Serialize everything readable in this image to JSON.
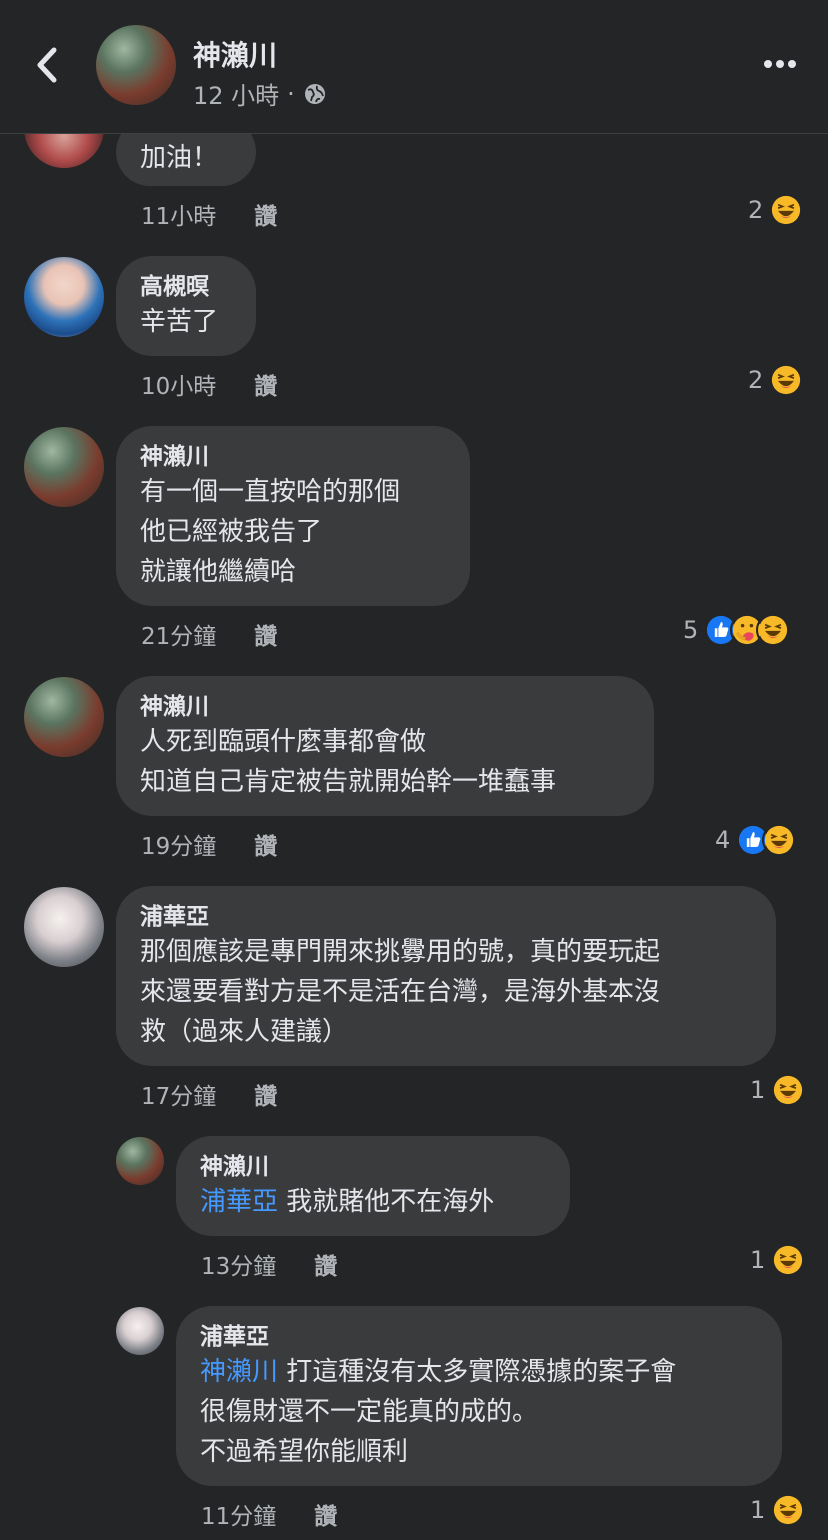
{
  "header": {
    "name": "神瀨川",
    "time": "12 小時",
    "dot": "·"
  },
  "comments": [
    {
      "name": "",
      "text": "加油！",
      "time": "11小時",
      "like": "讚",
      "count": "2"
    },
    {
      "name": "高槻暝",
      "text": "辛苦了",
      "time": "10小時",
      "like": "讚",
      "count": "2"
    },
    {
      "name": "神瀨川",
      "text": "有一個一直按哈的那個\n他已經被我告了\n就讓他繼續哈",
      "time": "21分鐘",
      "like": "讚",
      "count": "5"
    },
    {
      "name": "神瀨川",
      "text": "人死到臨頭什麼事都會做\n知道自己肯定被告就開始幹一堆蠢事",
      "time": "19分鐘",
      "like": "讚",
      "count": "4"
    },
    {
      "name": "浦華亞",
      "text": "那個應該是專門開來挑釁用的號，真的要玩起\n來還要看對方是不是活在台灣，是海外基本沒\n救（過來人建議）",
      "time": "17分鐘",
      "like": "讚",
      "count": "1"
    },
    {
      "name": "神瀨川",
      "mention": "浦華亞",
      "text": " 我就賭他不在海外",
      "time": "13分鐘",
      "like": "讚",
      "count": "1"
    },
    {
      "name": "浦華亞",
      "mention": "神瀨川",
      "text_first": " 打這種沒有太多實際憑據的案子會",
      "text": "很傷財還不一定能真的成的。\n不過希望你能順利",
      "time": "11分鐘",
      "like": "讚",
      "count": "1"
    }
  ],
  "colors": {
    "like": "#1877f2",
    "haha": "#f7b928",
    "mention": "#4599ff"
  },
  "icons": [
    "back-arrow-icon",
    "globe-icon",
    "more-icon",
    "like-reaction-icon",
    "care-reaction-icon",
    "haha-reaction-icon"
  ]
}
